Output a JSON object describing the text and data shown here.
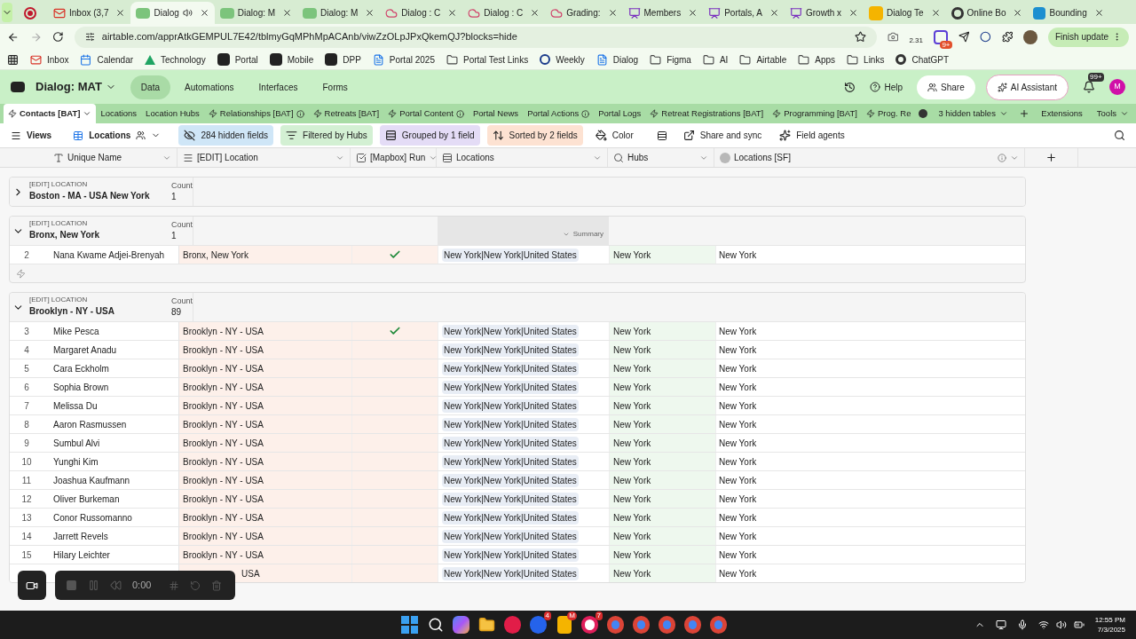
{
  "browser": {
    "tabs": [
      {
        "kind": "record",
        "selected": false
      },
      {
        "title": "Inbox (3,7",
        "kind": "mail",
        "selected": false
      },
      {
        "title": "Dialog",
        "kind": "di",
        "selected": true,
        "audio": true
      },
      {
        "title": "Dialog: M",
        "kind": "di",
        "selected": false,
        "audio": false
      },
      {
        "title": "Dialog: M",
        "kind": "di",
        "selected": false,
        "audio": false
      },
      {
        "title": "Dialog : C",
        "kind": "cloud",
        "selected": false,
        "audio": false
      },
      {
        "title": "Dialog : C",
        "kind": "cloud",
        "selected": false,
        "audio": false
      },
      {
        "title": "Grading:",
        "kind": "cloud",
        "selected": false,
        "audio": false
      },
      {
        "title": "Members",
        "kind": "board",
        "selected": false,
        "audio": false
      },
      {
        "title": "Portals, A",
        "kind": "board",
        "selected": false,
        "audio": false
      },
      {
        "title": "Growth x",
        "kind": "board",
        "selected": false,
        "audio": false
      },
      {
        "title": "Dialog Te",
        "kind": "diy",
        "selected": false,
        "audio": false
      },
      {
        "title": "Online Bo",
        "kind": "gpt",
        "selected": false,
        "audio": false
      },
      {
        "title": "Bounding",
        "kind": "bbox",
        "selected": false,
        "audio": false
      }
    ],
    "url": "airtable.com/apprAtkGEMPUL7E42/tblmyGqMPhMpACAnb/viwZzOLpJPxQkemQJ?blocks=hide",
    "extension_reading": "2.31",
    "extension_badge": "9+",
    "update_button": "Finish update",
    "bookmarks": [
      {
        "label": "Inbox",
        "kind": "mail"
      },
      {
        "label": "Calendar",
        "kind": "cal"
      },
      {
        "label": "Technology",
        "kind": "drive"
      },
      {
        "label": "Portal",
        "kind": "a"
      },
      {
        "label": "Mobile",
        "kind": "a"
      },
      {
        "label": "DPP",
        "kind": "a"
      },
      {
        "label": "Portal 2025",
        "kind": "doc"
      },
      {
        "label": "Portal Test Links",
        "kind": "folder"
      },
      {
        "label": "Weekly",
        "kind": "ring"
      },
      {
        "label": "Dialog",
        "kind": "doc"
      },
      {
        "label": "Figma",
        "kind": "folder"
      },
      {
        "label": "AI",
        "kind": "folder"
      },
      {
        "label": "Airtable",
        "kind": "folder"
      },
      {
        "label": "Apps",
        "kind": "folder"
      },
      {
        "label": "Links",
        "kind": "folder"
      },
      {
        "label": "ChatGPT",
        "kind": "gpt"
      }
    ]
  },
  "app": {
    "base_name": "Dialog: MAT",
    "nav": [
      {
        "label": "Data",
        "selected": true
      },
      {
        "label": "Automations",
        "selected": false
      },
      {
        "label": "Interfaces",
        "selected": false
      },
      {
        "label": "Forms",
        "selected": false
      }
    ],
    "help": "Help",
    "share": "Share",
    "ai_assistant": "AI Assistant",
    "notification_badge": "99+",
    "avatar": "M"
  },
  "tables": {
    "items": [
      {
        "label": "Contacts [BAT]",
        "synced": true,
        "info": false,
        "selected": true
      },
      {
        "label": "Locations",
        "synced": false,
        "info": false,
        "selected": false
      },
      {
        "label": "Location Hubs",
        "synced": false,
        "info": false,
        "selected": false
      },
      {
        "label": "Relationships [BAT]",
        "synced": true,
        "info": true,
        "selected": false
      },
      {
        "label": "Retreats [BAT]",
        "synced": true,
        "info": false,
        "selected": false
      },
      {
        "label": "Portal Content",
        "synced": true,
        "info": true,
        "selected": false
      },
      {
        "label": "Portal News",
        "synced": false,
        "info": false,
        "selected": false
      },
      {
        "label": "Portal Actions",
        "synced": false,
        "info": true,
        "selected": false
      },
      {
        "label": "Portal Logs",
        "synced": false,
        "info": false,
        "selected": false
      },
      {
        "label": "Retreat Registrations [BAT]",
        "synced": true,
        "info": false,
        "selected": false
      },
      {
        "label": "Programming [BAT]",
        "synced": true,
        "info": false,
        "selected": false
      },
      {
        "label": "Prog. Re",
        "synced": true,
        "info": false,
        "selected": false
      }
    ],
    "hidden_tables": "3 hidden tables",
    "extensions": "Extensions",
    "tools": "Tools"
  },
  "toolbar": {
    "views": "Views",
    "view_name": "Locations",
    "items": [
      {
        "label": "284 hidden fields",
        "kind": "eye",
        "color": "#cfe6f7"
      },
      {
        "label": "Filtered by Hubs",
        "kind": "filter",
        "color": "#d3f0d3"
      },
      {
        "label": "Grouped by 1 field",
        "kind": "group",
        "color": "#e4dcf6"
      },
      {
        "label": "Sorted by 2 fields",
        "kind": "sort",
        "color": "#fde2d2"
      },
      {
        "label": "Color",
        "kind": "color"
      },
      {
        "label": "Share and sync",
        "kind": "share"
      },
      {
        "label": "Field agents",
        "kind": "spark"
      }
    ]
  },
  "grid": {
    "columns": [
      {
        "label": "Unique Name",
        "kind": "formula"
      },
      {
        "label": "[EDIT] Location",
        "kind": "text"
      },
      {
        "label": "[Mapbox] Run",
        "kind": "checkbox"
      },
      {
        "label": "Locations",
        "kind": "link"
      },
      {
        "label": "Hubs",
        "kind": "lookup"
      },
      {
        "label": "Locations [SF]",
        "kind": "sync"
      }
    ],
    "groups": [
      {
        "field": "[EDIT] LOCATION",
        "value": "Boston - MA - USA New York",
        "count_label": "Count",
        "count": "1",
        "expanded": false
      },
      {
        "field": "[EDIT] LOCATION",
        "value": "Bronx, New York",
        "count_label": "Count",
        "count": "1",
        "expanded": true,
        "summary": "Summary",
        "add_row": true,
        "rows": [
          {
            "number": "2",
            "name": "Nana Kwame Adjei-Brenyah",
            "location": "Bronx, New York",
            "run": true,
            "locations": "New York|New York|United States",
            "hubs": "New York",
            "locations_sf": "New York"
          }
        ]
      },
      {
        "field": "[EDIT] LOCATION",
        "value": "Brooklyn - NY - USA",
        "count_label": "Count",
        "count": "89",
        "expanded": true,
        "add_row": false,
        "rows": [
          {
            "number": "3",
            "name": "Mike Pesca",
            "location": "Brooklyn - NY - USA",
            "run": true,
            "locations": "New York|New York|United States",
            "hubs": "New York",
            "locations_sf": "New York"
          },
          {
            "number": "4",
            "name": "Margaret Anadu",
            "location": "Brooklyn - NY - USA",
            "run": false,
            "locations": "New York|New York|United States",
            "hubs": "New York",
            "locations_sf": "New York"
          },
          {
            "number": "5",
            "name": "Cara Eckholm",
            "location": "Brooklyn - NY - USA",
            "run": false,
            "locations": "New York|New York|United States",
            "hubs": "New York",
            "locations_sf": "New York"
          },
          {
            "number": "6",
            "name": "Sophia Brown",
            "location": "Brooklyn - NY - USA",
            "run": false,
            "locations": "New York|New York|United States",
            "hubs": "New York",
            "locations_sf": "New York"
          },
          {
            "number": "7",
            "name": "Melissa Du",
            "location": "Brooklyn - NY - USA",
            "run": false,
            "locations": "New York|New York|United States",
            "hubs": "New York",
            "locations_sf": "New York"
          },
          {
            "number": "8",
            "name": "Aaron Rasmussen",
            "location": "Brooklyn - NY - USA",
            "run": false,
            "locations": "New York|New York|United States",
            "hubs": "New York",
            "locations_sf": "New York"
          },
          {
            "number": "9",
            "name": "Sumbul Alvi",
            "location": "Brooklyn - NY - USA",
            "run": false,
            "locations": "New York|New York|United States",
            "hubs": "New York",
            "locations_sf": "New York"
          },
          {
            "number": "10",
            "name": "Yunghi Kim",
            "location": "Brooklyn - NY - USA",
            "run": false,
            "locations": "New York|New York|United States",
            "hubs": "New York",
            "locations_sf": "New York"
          },
          {
            "number": "11",
            "name": "Joashua Kaufmann",
            "location": "Brooklyn - NY - USA",
            "run": false,
            "locations": "New York|New York|United States",
            "hubs": "New York",
            "locations_sf": "New York"
          },
          {
            "number": "12",
            "name": "Oliver Burkeman",
            "location": "Brooklyn - NY - USA",
            "run": false,
            "locations": "New York|New York|United States",
            "hubs": "New York",
            "locations_sf": "New York"
          },
          {
            "number": "13",
            "name": "Conor Russomanno",
            "location": "Brooklyn - NY - USA",
            "run": false,
            "locations": "New York|New York|United States",
            "hubs": "New York",
            "locations_sf": "New York"
          },
          {
            "number": "14",
            "name": "Jarrett Revels",
            "location": "Brooklyn - NY - USA",
            "run": false,
            "locations": "New York|New York|United States",
            "hubs": "New York",
            "locations_sf": "New York"
          },
          {
            "number": "15",
            "name": "Hilary Leichter",
            "location": "Brooklyn - NY - USA",
            "run": false,
            "locations": "New York|New York|United States",
            "hubs": "New York",
            "locations_sf": "New York"
          },
          {
            "location": "USA",
            "run": false,
            "locations": "New York|New York|United States",
            "hubs": "New York",
            "locations_sf": "New York"
          }
        ]
      }
    ]
  },
  "recorder": {
    "time": "0:00"
  },
  "taskbar": {
    "apps": [
      {
        "kind": "start"
      },
      {
        "kind": "search"
      },
      {
        "kind": "copilot"
      },
      {
        "kind": "folder"
      },
      {
        "kind": "play"
      },
      {
        "kind": "zm",
        "badge": "4"
      },
      {
        "kind": "files",
        "badge": "M"
      },
      {
        "kind": "slack",
        "badge": "7"
      },
      {
        "kind": "chrome"
      },
      {
        "kind": "chrome"
      },
      {
        "kind": "chrome"
      },
      {
        "kind": "chrome"
      },
      {
        "kind": "chrome"
      }
    ],
    "time": "12:55 PM",
    "date": "7/3/2025"
  }
}
